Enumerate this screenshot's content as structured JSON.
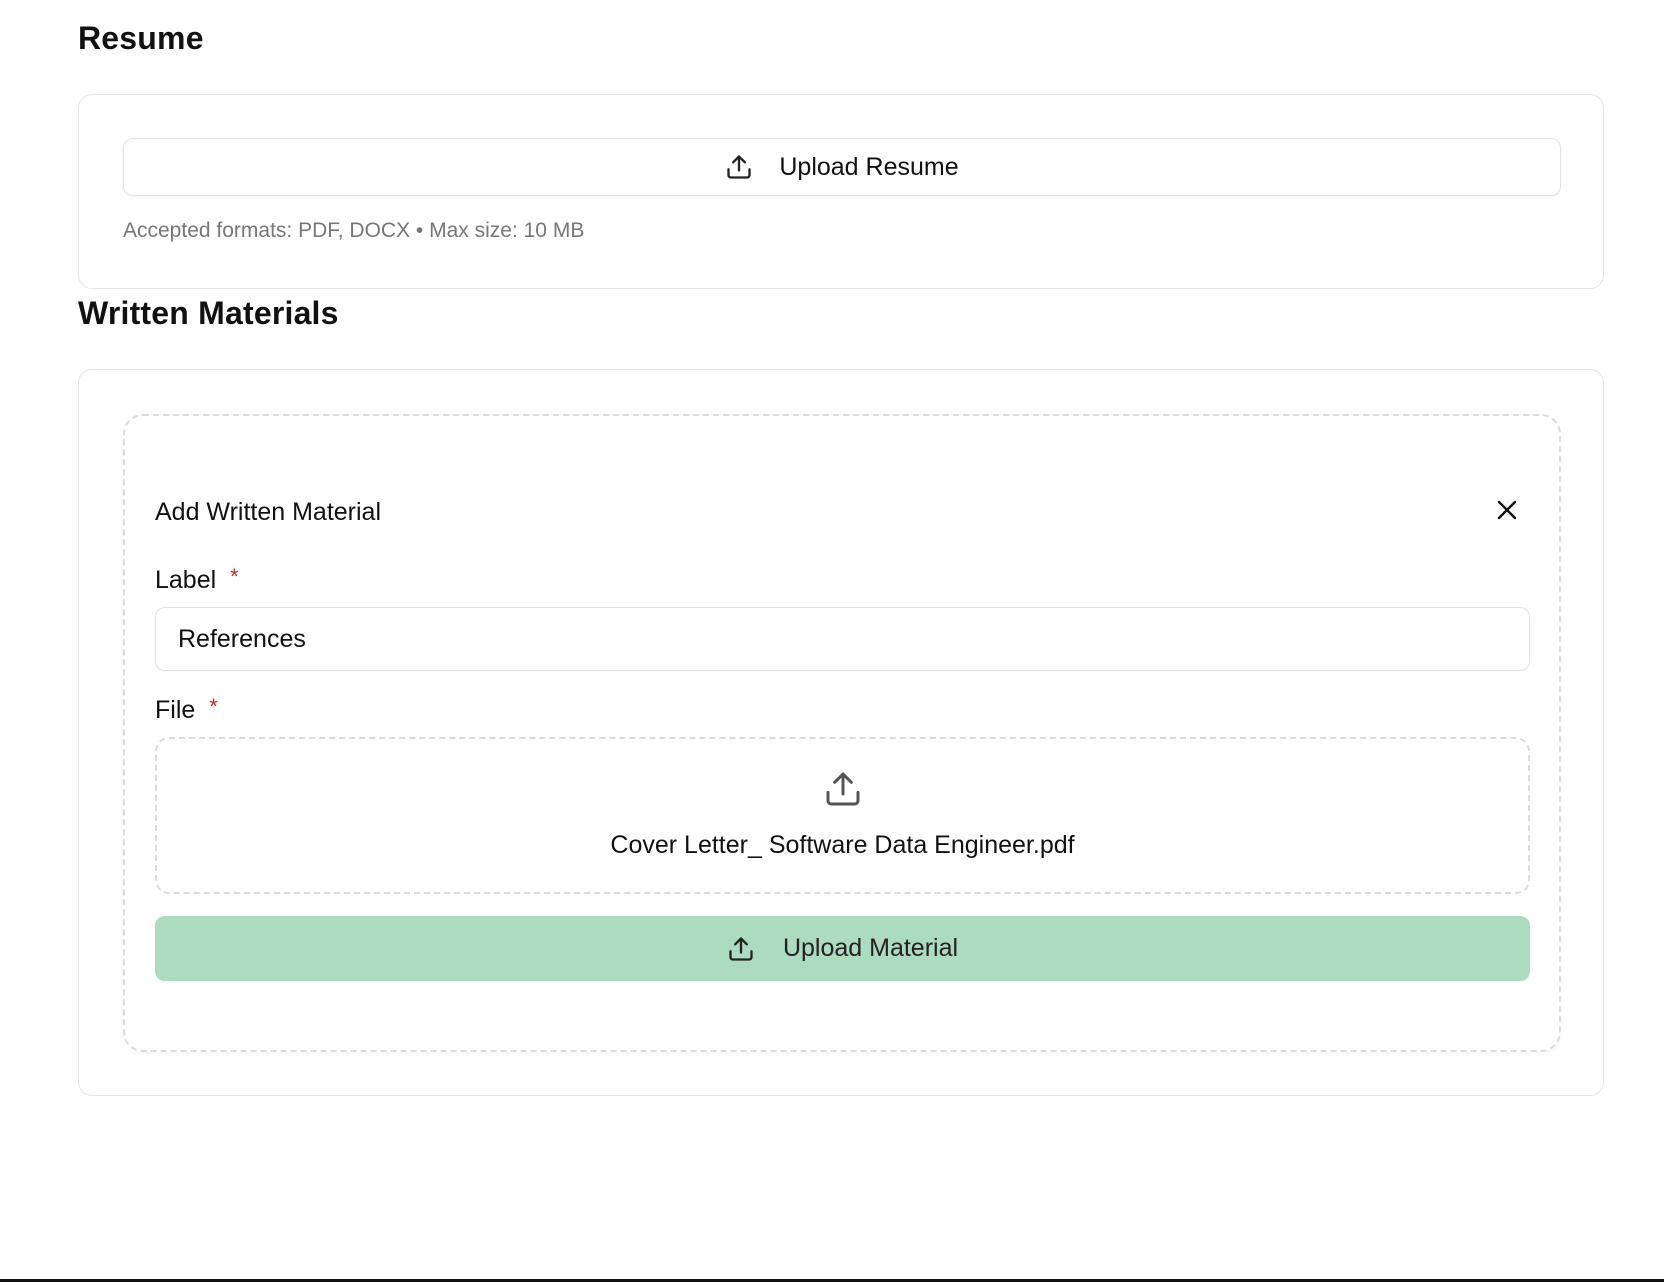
{
  "resume": {
    "heading": "Resume",
    "upload_button_label": "Upload Resume",
    "upload_icon": "upload-icon",
    "hint": "Accepted formats: PDF, DOCX • Max size: 10 MB"
  },
  "written_materials": {
    "heading": "Written Materials",
    "form": {
      "title": "Add Written Material",
      "close_icon": "close-icon",
      "label_field": {
        "label": "Label",
        "required_marker": "*",
        "value": "References"
      },
      "file_field": {
        "label": "File",
        "required_marker": "*",
        "upload_icon": "upload-icon",
        "selected_file": "Cover Letter_ Software Data Engineer.pdf"
      },
      "submit_button_label": "Upload Material"
    }
  },
  "colors": {
    "primary_button_bg": "#addbbf",
    "required_marker": "#c62828",
    "hint_text": "#777777"
  }
}
